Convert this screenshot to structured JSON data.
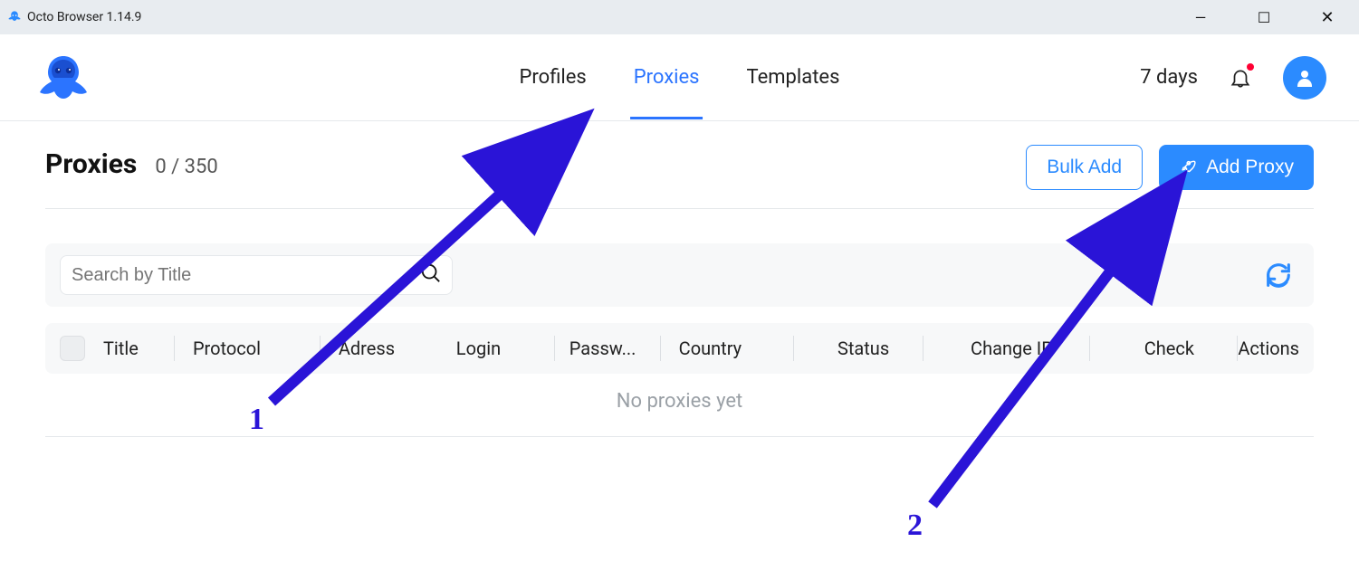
{
  "titlebar": {
    "title": "Octo Browser 1.14.9"
  },
  "header": {
    "tabs": [
      {
        "label": "Profiles",
        "active": false
      },
      {
        "label": "Proxies",
        "active": true
      },
      {
        "label": "Templates",
        "active": false
      }
    ],
    "days": "7 days"
  },
  "page": {
    "title": "Proxies",
    "count": "0 / 350",
    "bulk_add": "Bulk Add",
    "add_proxy": "Add Proxy"
  },
  "search": {
    "placeholder": "Search by Title"
  },
  "table": {
    "columns": {
      "title": "Title",
      "protocol": "Protocol",
      "address": "Adress",
      "login": "Login",
      "password": "Passw...",
      "country": "Country",
      "status": "Status",
      "change_ip": "Change IP",
      "check": "Check",
      "actions": "Actions"
    },
    "empty": "No proxies yet"
  },
  "annotations": {
    "one": "1",
    "two": "2"
  },
  "colors": {
    "accent": "#2b8bff",
    "arrow": "#2a14d7"
  }
}
